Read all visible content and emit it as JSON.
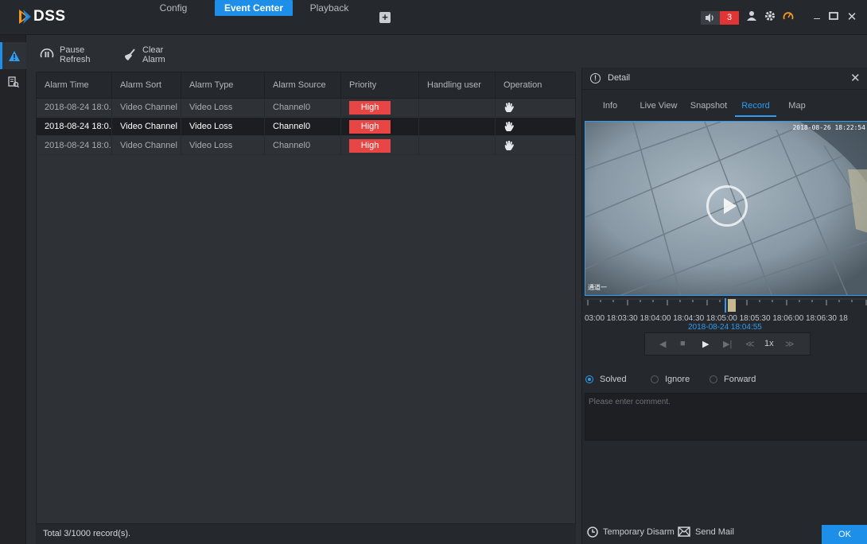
{
  "app": {
    "logo_text": "DSS",
    "nav": [
      {
        "label": "Config"
      },
      {
        "label": "Event Center",
        "active": true
      },
      {
        "label": "Playback"
      }
    ],
    "alarm_count": "3",
    "accent_color": "#1e8fe8"
  },
  "toolbar": {
    "pause_refresh": "Pause Refresh",
    "clear_alarm": "Clear Alarm"
  },
  "table": {
    "columns": [
      "Alarm Time",
      "Alarm Sort",
      "Alarm Type",
      "Alarm Source",
      "Priority",
      "Handling user",
      "Operation"
    ],
    "rows": [
      {
        "time": "2018-08-24 18:0...",
        "sort": "Video Channel",
        "type": "Video Loss",
        "source": "Channel0",
        "priority": "High",
        "user": ""
      },
      {
        "time": "2018-08-24 18:0...",
        "sort": "Video Channel",
        "type": "Video Loss",
        "source": "Channel0",
        "priority": "High",
        "user": "",
        "selected": true
      },
      {
        "time": "2018-08-24 18:0...",
        "sort": "Video Channel",
        "type": "Video Loss",
        "source": "Channel0",
        "priority": "High",
        "user": ""
      }
    ],
    "footer": "Total 3/1000 record(s)."
  },
  "detail": {
    "title": "Detail",
    "tabs": [
      "Info",
      "Live View",
      "Snapshot",
      "Record",
      "Map"
    ],
    "active_tab": "Record",
    "video_timestamp": "2018-08-26 18:22:54",
    "video_channel": "通道一",
    "timeline_labels": "03:00 18:03:30 18:04:00 18:04:30 18:05:00 18:05:30 18:06:00 18:06:30 18",
    "timeline_current": "2018-08-24 18:04:55",
    "speed": "1x",
    "radios": [
      {
        "label": "Solved",
        "checked": true
      },
      {
        "label": "Ignore",
        "checked": false
      },
      {
        "label": "Forward",
        "checked": false
      }
    ],
    "comment_placeholder": "Please enter comment.",
    "temporary_disarm": "Temporary Disarm",
    "send_mail": "Send Mail",
    "ok": "OK"
  }
}
